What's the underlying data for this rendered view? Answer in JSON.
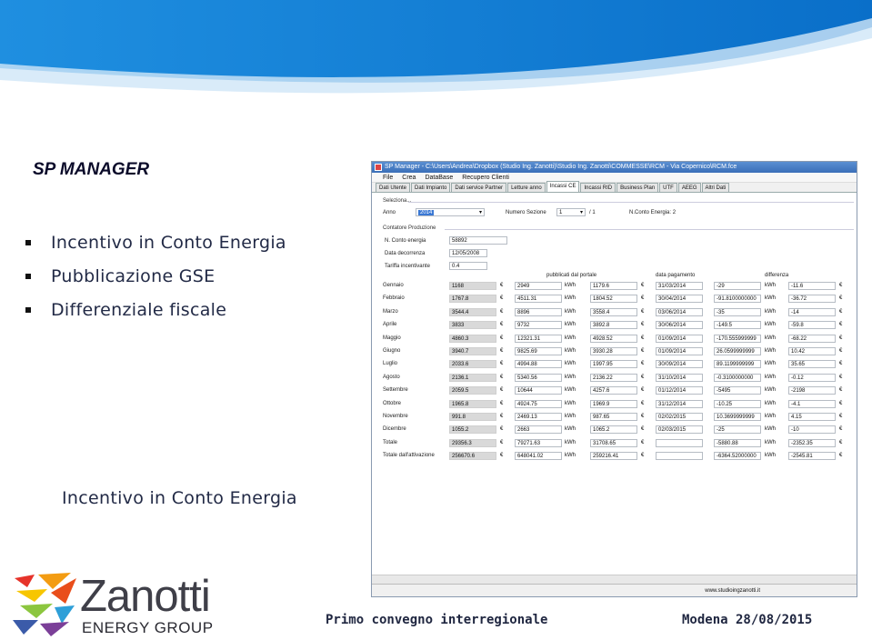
{
  "slide": {
    "title": "SP MANAGER",
    "bullets": [
      "Incentivo in Conto Energia",
      "Pubblicazione GSE",
      "Differenziale fiscale"
    ],
    "caption": "Incentivo in Conto Energia",
    "footer_event": "Primo convegno interregionale",
    "footer_date": "Modena 28/08/2015",
    "logo": {
      "name": "Zanotti",
      "subtitle": "ENERGY GROUP"
    }
  },
  "window": {
    "title": "SP Manager - C:\\Users\\Andrea\\Dropbox (Studio Ing. Zanotti)\\Studio Ing. Zanotti\\COMMESSE\\RCM - Via Copernico\\RCM.fce",
    "menu": [
      "File",
      "Crea",
      "DataBase",
      "Recupero Clienti"
    ],
    "tabs": [
      "Dati Utente",
      "Dati Impianto",
      "Dati service Partner",
      "Letture anno",
      "Incassi CE",
      "Incassi RID",
      "Business Plan",
      "UTF",
      "AEEG",
      "Altri Dati"
    ],
    "active_tab": 4,
    "selection": {
      "group_label": "Seleziona...",
      "anno_label": "Anno",
      "anno_value": "2014",
      "numero_sezione_label": "Numero Sezione",
      "numero_sezione_value": "1",
      "numero_sezione_total": "/ 1",
      "n_conto_energia_text": "N.Conto Energia: 2"
    },
    "contatore": {
      "group_label": "Contatore Produzione",
      "n_conto_energia_label": "N. Conto energia",
      "n_conto_energia_value": "58892",
      "data_decorrenza_label": "Data decorrenza",
      "data_decorrenza_value": "12/05/2008",
      "tariffa_label": "Tariffa incentivante",
      "tariffa_value": "0.4"
    },
    "headers": {
      "pubblicati": "pubblicati dal portale",
      "data_pagamento": "data pagamento",
      "differenza": "differenza"
    },
    "units": {
      "eur": "€",
      "kwh": "kWh"
    },
    "rows": [
      {
        "label": "Gennaio",
        "c1": "1168",
        "c2": "2949",
        "c3": "1179.6",
        "date": "31/03/2014",
        "d1": "-29",
        "d2": "-11.6"
      },
      {
        "label": "Febbraio",
        "c1": "1767.8",
        "c2": "4511.31",
        "c3": "1804.52",
        "date": "30/04/2014",
        "d1": "-91.8100000000",
        "d2": "-36.72"
      },
      {
        "label": "Marzo",
        "c1": "3544.4",
        "c2": "8896",
        "c3": "3558.4",
        "date": "03/06/2014",
        "d1": "-35",
        "d2": "-14"
      },
      {
        "label": "Aprile",
        "c1": "3833",
        "c2": "9732",
        "c3": "3892.8",
        "date": "30/06/2014",
        "d1": "-149.5",
        "d2": "-59.8"
      },
      {
        "label": "Maggio",
        "c1": "4860.3",
        "c2": "12321.31",
        "c3": "4928.52",
        "date": "01/09/2014",
        "d1": "-170.555999999",
        "d2": "-68.22"
      },
      {
        "label": "Giugno",
        "c1": "3940.7",
        "c2": "9825.69",
        "c3": "3930.28",
        "date": "01/09/2014",
        "d1": "26.0599999999",
        "d2": "10.42"
      },
      {
        "label": "Luglio",
        "c1": "2033.6",
        "c2": "4994.88",
        "c3": "1997.95",
        "date": "30/09/2014",
        "d1": "89.1199999999",
        "d2": "35.65"
      },
      {
        "label": "Agosto",
        "c1": "2136.1",
        "c2": "5340.56",
        "c3": "2136.22",
        "date": "31/10/2014",
        "d1": "-0.3100000000",
        "d2": "-0.12"
      },
      {
        "label": "Settembre",
        "c1": "2059.5",
        "c2": "10644",
        "c3": "4257.6",
        "date": "01/12/2014",
        "d1": "-5495",
        "d2": "-2198"
      },
      {
        "label": "Ottobre",
        "c1": "1965.8",
        "c2": "4924.75",
        "c3": "1969.9",
        "date": "31/12/2014",
        "d1": "-10.25",
        "d2": "-4.1"
      },
      {
        "label": "Novembre",
        "c1": "991.8",
        "c2": "2469.13",
        "c3": "987.65",
        "date": "02/02/2015",
        "d1": "10.3699999999",
        "d2": "4.15"
      },
      {
        "label": "Dicembre",
        "c1": "1055.2",
        "c2": "2663",
        "c3": "1065.2",
        "date": "02/03/2015",
        "d1": "-25",
        "d2": "-10"
      },
      {
        "label": "Totale",
        "c1": "29356.3",
        "c2": "79271.63",
        "c3": "31708.65",
        "date": "",
        "d1": "-5880.88",
        "d2": "-2352.35"
      },
      {
        "label": "Totale dall'attivazione",
        "c1": "256670.6",
        "c2": "648041.02",
        "c3": "259216.41",
        "date": "",
        "d1": "-6364.52000000",
        "d2": "-2545.81"
      }
    ],
    "status_url": "www.studioingzanotti.it"
  }
}
